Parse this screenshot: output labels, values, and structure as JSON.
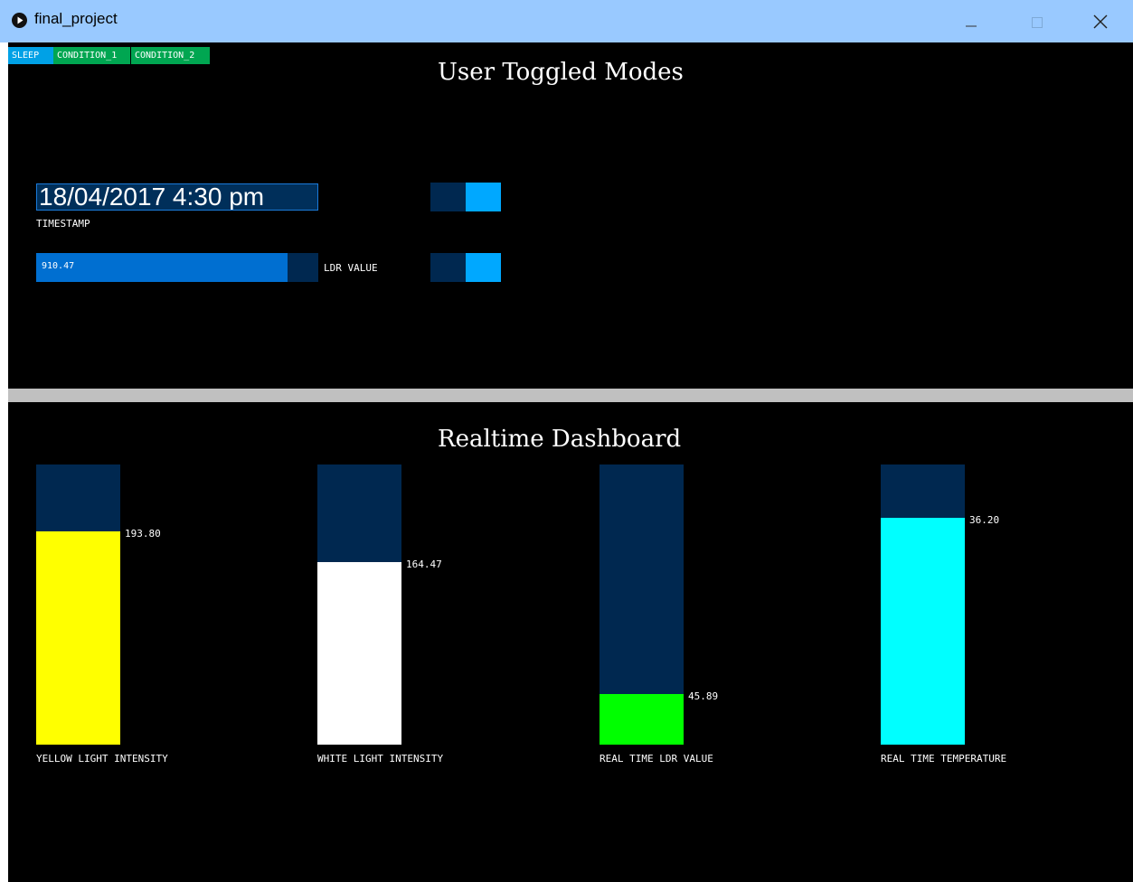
{
  "window": {
    "title": "final_project"
  },
  "tabs": [
    {
      "label": "SLEEP",
      "color": "#00a1e6"
    },
    {
      "label": "CONDITION_1",
      "color": "#00a651"
    },
    {
      "label": "CONDITION_2",
      "color": "#00a651"
    }
  ],
  "modes_section": {
    "title": "User Toggled Modes",
    "timestamp": {
      "value": "18/04/2017 4:30 pm",
      "label": "TIMESTAMP"
    },
    "ldr_slider": {
      "value": "910.47",
      "label": "LDR VALUE",
      "fill_fraction": 0.89
    },
    "toggles": [
      {
        "name": "toggle-1",
        "state": "on"
      },
      {
        "name": "toggle-2",
        "state": "on"
      }
    ]
  },
  "dashboard": {
    "title": "Realtime Dashboard",
    "bars": [
      {
        "label": "YELLOW LIGHT INTENSITY",
        "value": "193.80",
        "level": 0.76,
        "color": "#ffff00"
      },
      {
        "label": "WHITE LIGHT INTENSITY",
        "value": "164.47",
        "level": 0.65,
        "color": "#ffffff"
      },
      {
        "label": "REAL TIME LDR VALUE",
        "value": "45.89",
        "level": 0.18,
        "color": "#00ff00"
      },
      {
        "label": "REAL TIME TEMPERATURE",
        "value": "36.20",
        "level": 0.81,
        "color": "#00ffff"
      }
    ]
  },
  "colors": {
    "titlebar": "#99c9ff",
    "track": "#002850",
    "accent_blue": "#00a8ff",
    "slider_fill": "#006fd1",
    "divider": "#c0c0c0"
  }
}
